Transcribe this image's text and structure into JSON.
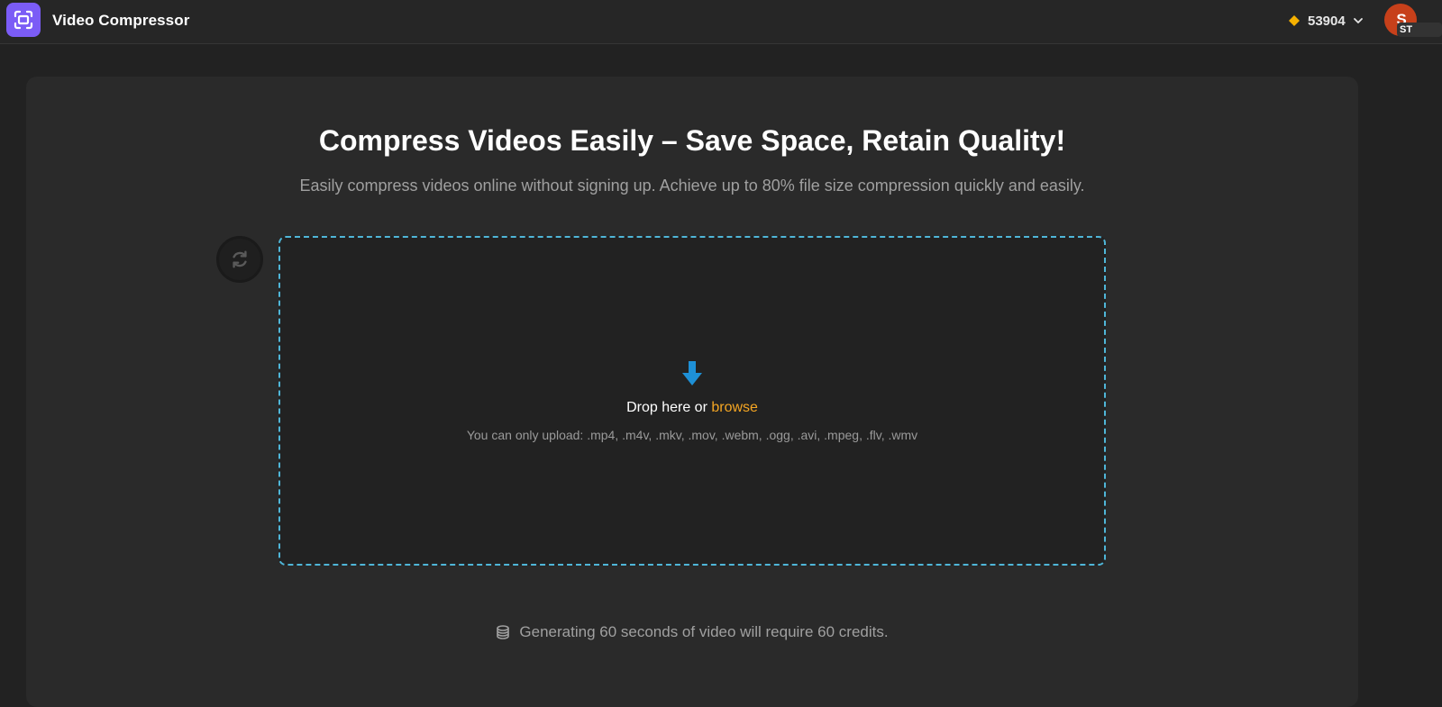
{
  "header": {
    "title": "Video Compressor",
    "credits": "53904",
    "avatar_initial": "S",
    "avatar_tag": "ST",
    "colors": {
      "logo": "#7b5cf6",
      "credit_icon": "#f5b100",
      "avatar": "#c7401a"
    }
  },
  "main": {
    "headline": "Compress Videos Easily – Save Space, Retain Quality!",
    "subhead": "Easily compress videos online without signing up. Achieve up to 80% file size compression quickly and easily."
  },
  "dropzone": {
    "drop_text": "Drop here or ",
    "browse_label": "browse",
    "hint": "You can only upload: .mp4, .m4v, .mkv, .mov, .webm, .ogg, .avi, .mpeg, .flv, .wmv",
    "border_color": "#4fb6d8",
    "link_color": "#f5a623",
    "arrow_color": "#1e90d6"
  },
  "footer": {
    "cost_note": "Generating 60 seconds of video will require 60 credits."
  }
}
